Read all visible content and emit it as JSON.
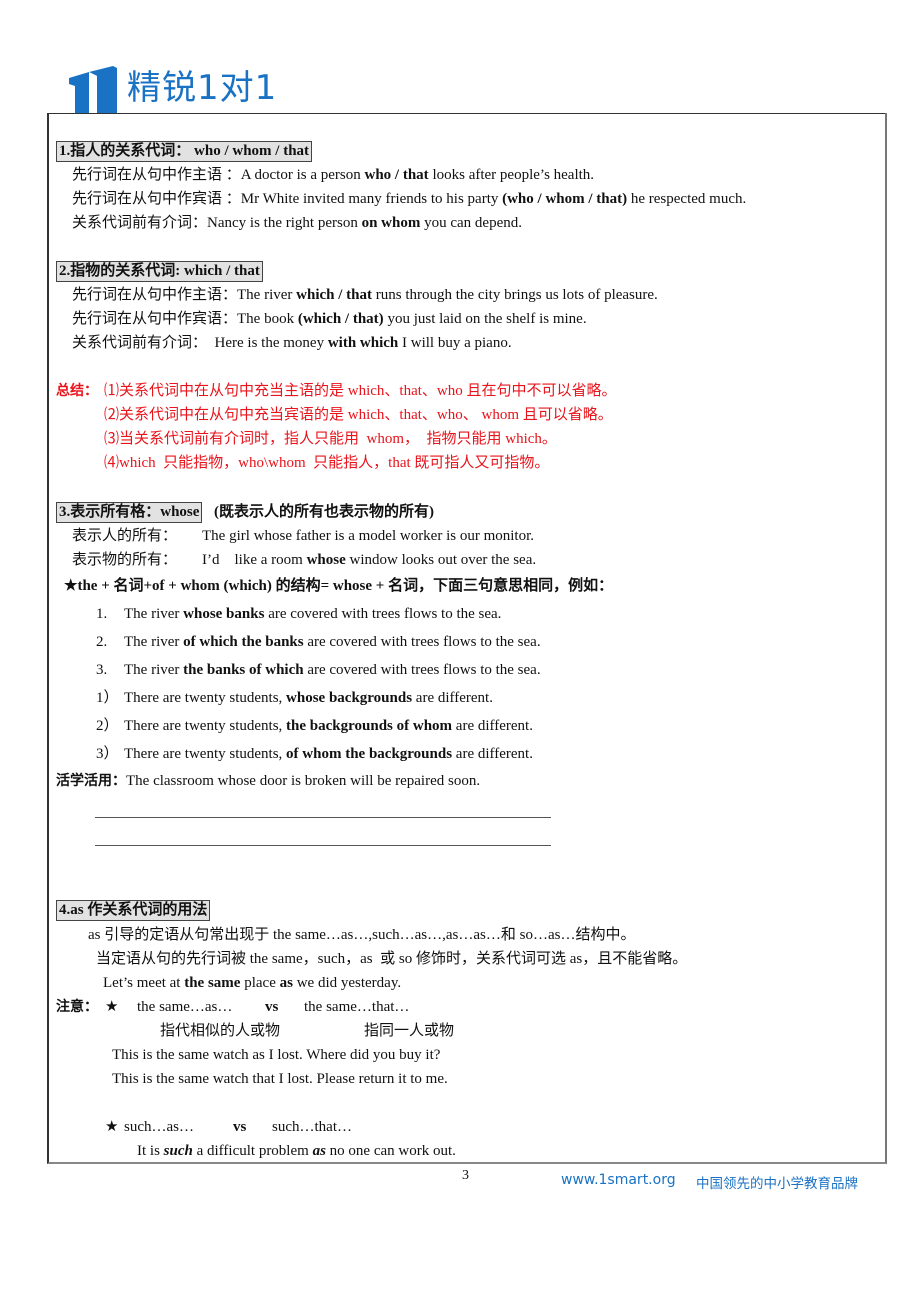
{
  "header": {
    "brand_title": "精锐1对1",
    "logo_icon": "building-one-icon",
    "brand_color": "#1a72c4"
  },
  "sections": {
    "s1": {
      "heading_cn": "1.指人的关系代词：",
      "heading_en": "who / whom / that",
      "rows": [
        {
          "label": "先行词在从句中作主语 ：",
          "pre": "A doctor is a person ",
          "bold": "who / that",
          "post": " looks after people’s health."
        },
        {
          "label": "先行词在从句中作宾语 ：",
          "pre": "Mr White invited many friends to his party ",
          "bold": "(who / whom / that)",
          "post": " he respected much."
        },
        {
          "label": "关系代词前有介词：",
          "pre": "Nancy is the right person ",
          "bold": "on whom",
          "post": " you can depend."
        }
      ]
    },
    "s2": {
      "heading_cn": "2.指物的关系代词: ",
      "heading_en": "which / that",
      "rows": [
        {
          "label": "先行词在从句中作主语：",
          "pre": "The river ",
          "bold": "which / that",
          "post": " runs through the city brings us lots of pleasure."
        },
        {
          "label": "先行词在从句中作宾语：",
          "pre": "The book ",
          "bold": "(which / that)",
          "post": " you just laid on the shelf is mine."
        },
        {
          "label": "关系代词前有介词：",
          "pre": "  Here is the money ",
          "bold": "with which",
          "post": " I will buy a piano."
        }
      ]
    },
    "summary": {
      "label": "总结：",
      "color": "#e8141c",
      "items": [
        "⑴关系代词中在从句中充当主语的是 which、that、who 且在句中不可以省略。",
        "⑵关系代词中在从句中充当宾语的是 which、that、who、 whom 且可以省略。",
        "⑶当关系代词前有介词时，指人只能用  whom，  指物只能用 which。",
        "⑷which  只能指物，who\\whom  只能指人，that 既可指人又可指物。"
      ]
    },
    "s3": {
      "heading": "3.表示所有格：whose",
      "heading_note": "(既表示人的所有也表示物的所有)",
      "rows": [
        {
          "label": "表示人的所有：",
          "pre": "The girl whose father is a model worker is our monitor.",
          "bold": "",
          "post": ""
        },
        {
          "label": "表示物的所有：",
          "pre": "I’d    like a room ",
          "bold": "whose",
          "post": " window looks out over the sea."
        }
      ],
      "rule": "★the +  名词+of + whom (which)  的结构= whose +  名词，下面三句意思相同，例如：",
      "examples": [
        {
          "num": "1.",
          "pre": "The river ",
          "bold": "whose banks",
          "post": " are covered with trees flows to the sea."
        },
        {
          "num": "2.",
          "pre": "The river ",
          "bold": "of which the banks",
          "post": " are covered with trees flows to the sea."
        },
        {
          "num": "3.",
          "pre": "The river ",
          "bold": "the banks of which",
          "post": " are covered with trees flows to the sea."
        },
        {
          "num": "1）",
          "pre": "There are twenty students, ",
          "bold": "whose backgrounds",
          "post": " are different."
        },
        {
          "num": "2）",
          "pre": "There are twenty students, ",
          "bold": "the backgrounds of whom",
          "post": " are different."
        },
        {
          "num": "3）",
          "pre": "There are twenty students, ",
          "bold": "of whom the backgrounds",
          "post": " are different."
        }
      ],
      "practice_label": "活学活用：",
      "practice_text": "The classroom whose door is broken will be repaired soon."
    },
    "s4": {
      "heading": "4.as 作关系代词的用法",
      "line1": "as 引导的定语从句常出现于 the same…as…,such…as…,as…as…和 so…as…结构中。",
      "line2": "当定语从句的先行词被 the same，such，as  或 so 修饰时，关系代词可选 as，且不能省略。",
      "example_pre": "Let’s meet at ",
      "example_b1": "the same",
      "example_mid": " place ",
      "example_b2": "as",
      "example_post": " we did yesterday.",
      "note_label": "注意：",
      "star": "★",
      "cmp1_left": "the same…as…",
      "cmp1_vs": "vs",
      "cmp1_right": "the same…that…",
      "cmp1_left_cn": "指代相似的人或物",
      "cmp1_right_cn": "指同一人或物",
      "cmp1_ex1": "This is the same watch as I lost. Where did you buy it?",
      "cmp1_ex2": "This is the same watch that I lost. Please return it to me.",
      "cmp2_left": "such…as…",
      "cmp2_vs": "vs",
      "cmp2_right": "such…that…",
      "cmp2_ex_pre": "It is ",
      "cmp2_ex_b1": "such",
      "cmp2_ex_mid": " a difficult problem ",
      "cmp2_ex_b2": "as",
      "cmp2_ex_post": " no one can work out."
    }
  },
  "footer": {
    "page_number": "3",
    "website": "www.1smart.org",
    "slogan": "中国领先的中小学教育品牌"
  }
}
